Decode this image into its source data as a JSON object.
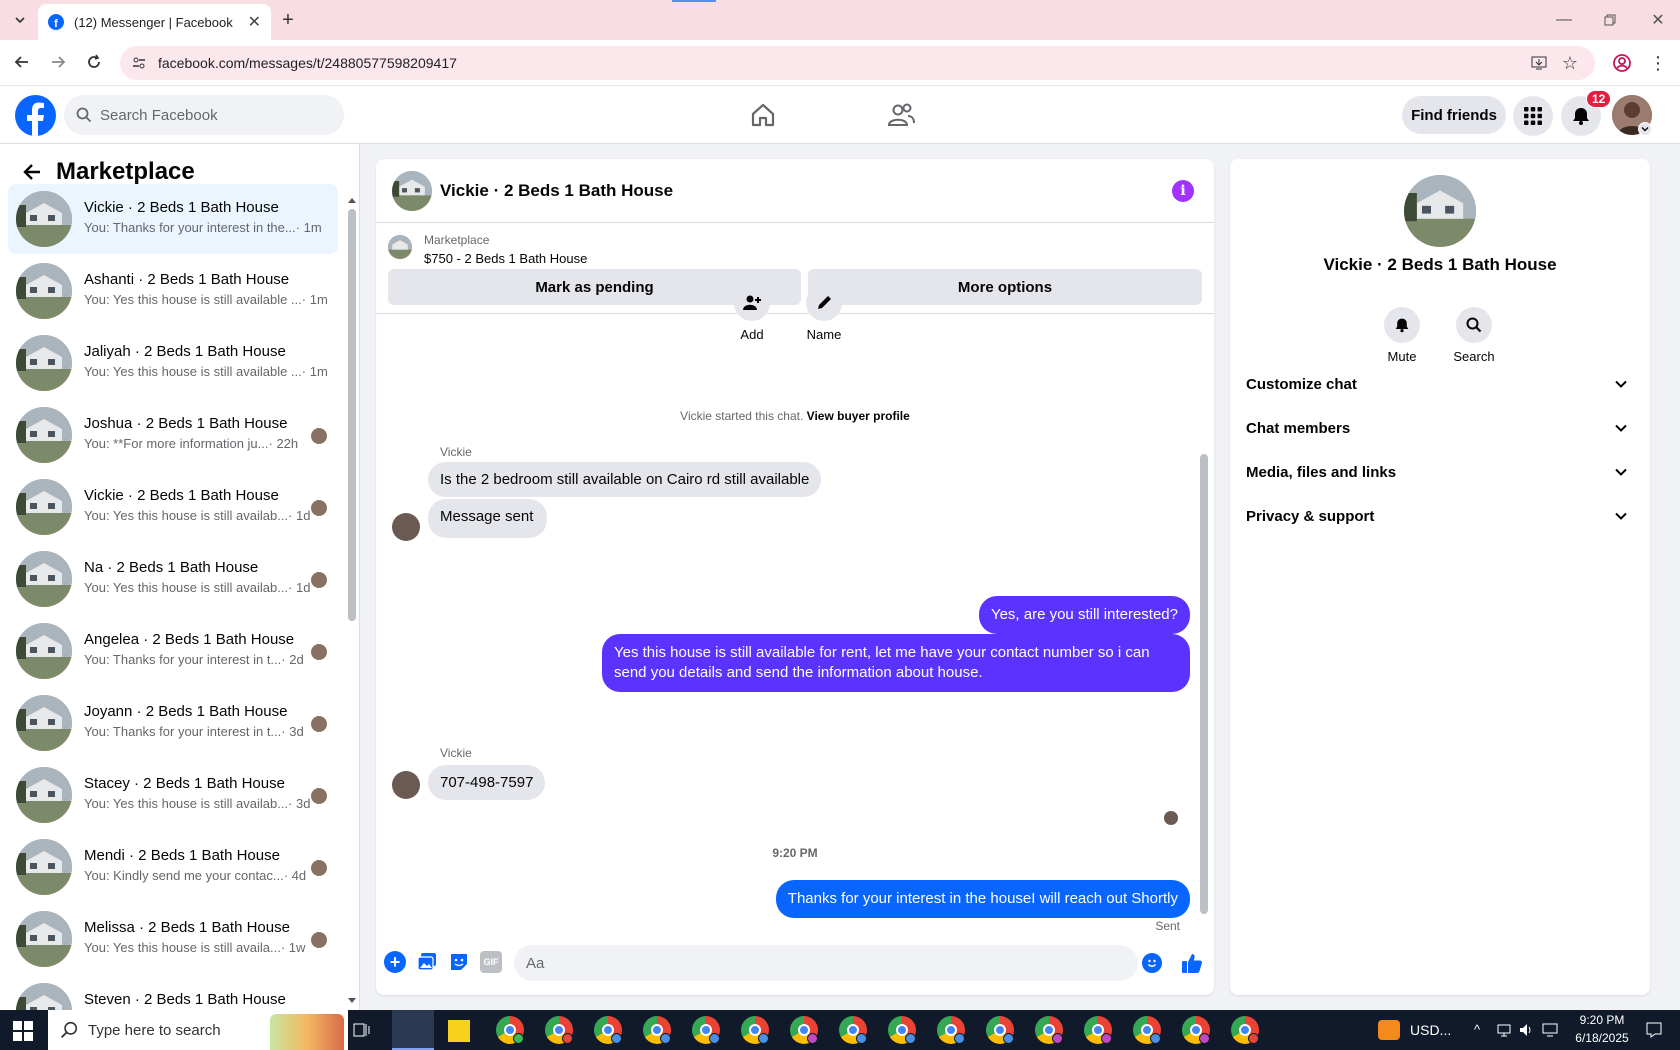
{
  "browser": {
    "tab_title": "(12) Messenger | Facebook",
    "url": "facebook.com/messages/t/24880577598209417"
  },
  "header": {
    "search_placeholder": "Search Facebook",
    "find_friends": "Find friends",
    "notification_count": "12"
  },
  "sidebar": {
    "title": "Marketplace",
    "conversations": [
      {
        "name": "Vickie · 2 Beds 1 Bath House",
        "preview": "You: Thanks for your interest in the...",
        "time": "· 1m"
      },
      {
        "name": "Ashanti · 2 Beds 1 Bath House",
        "preview": "You: Yes this house is still available ...",
        "time": "· 1m"
      },
      {
        "name": "Jaliyah · 2 Beds 1 Bath House",
        "preview": "You: Yes this house is still available ...",
        "time": "· 1m"
      },
      {
        "name": "Joshua · 2 Beds 1 Bath House",
        "preview": "You: **For more information ju...",
        "time": "· 22h"
      },
      {
        "name": "Vickie · 2 Beds 1 Bath House",
        "preview": "You: Yes this house is still availab...",
        "time": "· 1d"
      },
      {
        "name": "Na · 2 Beds 1 Bath House",
        "preview": "You: Yes this house is still availab...",
        "time": "· 1d"
      },
      {
        "name": "Angelea · 2 Beds 1 Bath House",
        "preview": "You: Thanks for your interest in t...",
        "time": "· 2d"
      },
      {
        "name": "Joyann · 2 Beds 1 Bath House",
        "preview": "You: Thanks for your interest in t...",
        "time": "· 3d"
      },
      {
        "name": "Stacey · 2 Beds 1 Bath House",
        "preview": "You: Yes this house is still availab...",
        "time": "· 3d"
      },
      {
        "name": "Mendi · 2 Beds 1 Bath House",
        "preview": "You: Kindly send me your contac...",
        "time": "· 4d"
      },
      {
        "name": "Melissa · 2 Beds 1 Bath House",
        "preview": "You: Yes this house is still availa...",
        "time": "· 1w"
      },
      {
        "name": "Steven · 2 Beds 1 Bath House",
        "preview": "",
        "time": ""
      }
    ]
  },
  "chat": {
    "title": "Vickie · 2 Beds 1 Bath House",
    "listing_source": "Marketplace",
    "listing_title": "$750 - 2 Beds 1 Bath House",
    "mark_pending": "Mark as pending",
    "more_options": "More options",
    "action_add": "Add",
    "action_name": "Name",
    "started_text": "Vickie started this chat.",
    "view_profile": "View buyer profile",
    "sender_name": "Vickie",
    "msg1": "Is the 2 bedroom still available on Cairo rd still available",
    "msg2": "Message sent",
    "msg3": "Yes, are you still interested?",
    "msg4": "Yes this house is still available for rent, let me have your contact number so i can send you details and send the information about house.",
    "msg5": "707-498-7597",
    "timestamp": "9:20 PM",
    "msg6": "Thanks for your interest in the houseI will reach out Shortly",
    "sent_status": "Sent",
    "input_placeholder": "Aa"
  },
  "info_panel": {
    "name": "Vickie · 2 Beds 1 Bath House",
    "mute": "Mute",
    "search": "Search",
    "sections": [
      "Customize chat",
      "Chat members",
      "Media, files and links",
      "Privacy & support"
    ]
  },
  "taskbar": {
    "search_placeholder": "Type here to search",
    "tray_text": "USD...",
    "time": "9:20 PM",
    "date": "6/18/2025"
  },
  "colors": {
    "accent": "#0866ff",
    "outgoing_bubble": "#5b33ff",
    "info_icon": "#a033ff"
  }
}
